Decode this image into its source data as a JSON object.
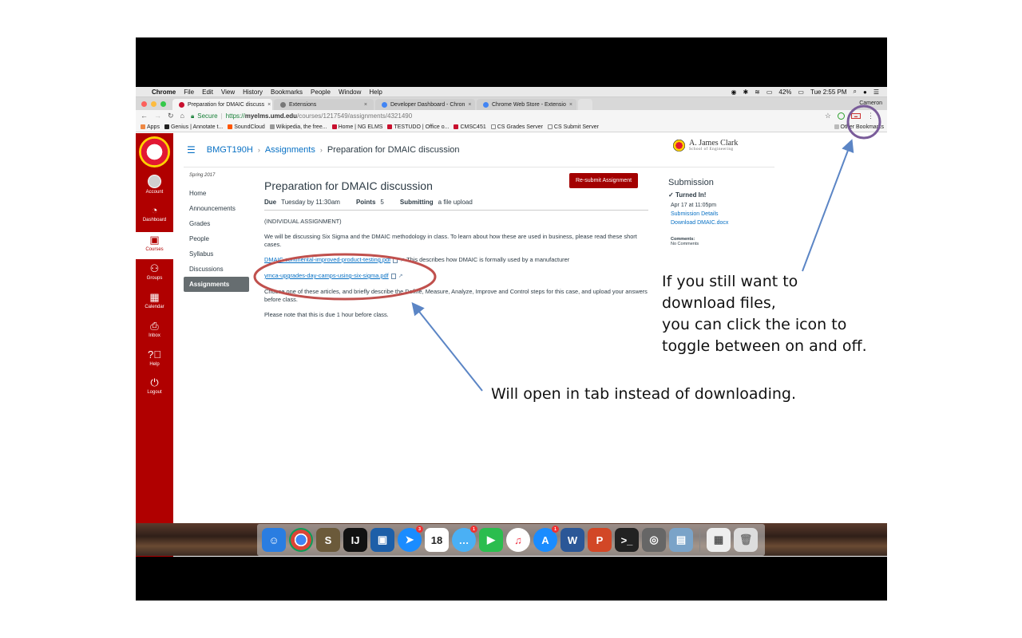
{
  "menubar": {
    "app": "Chrome",
    "menus": [
      "File",
      "Edit",
      "View",
      "History",
      "Bookmarks",
      "People",
      "Window",
      "Help"
    ],
    "battery": "42%",
    "time": "Tue 2:55 PM"
  },
  "tabs": [
    {
      "label": "Preparation for DMAIC discuss",
      "active": true
    },
    {
      "label": "Extensions",
      "active": false
    },
    {
      "label": "Developer Dashboard - Chron",
      "active": false
    },
    {
      "label": "Chrome Web Store - Extensio",
      "active": false
    }
  ],
  "profile": "Cameron",
  "address": {
    "secure_label": "Secure",
    "scheme": "https://",
    "host": "myelms.umd.edu",
    "path": "/courses/1217549/assignments/4321490"
  },
  "bookmarks": [
    "Apps",
    "Genius | Annotate t...",
    "SoundCloud",
    "Wikipedia, the free...",
    "Home | NG ELMS",
    "TESTUDO | Office o...",
    "CMSC451",
    "CS Grades Server",
    "CS Submit Server"
  ],
  "other_bookmarks": "Other Bookmarks",
  "global_nav": [
    {
      "label": "Account",
      "icon": "account-icon"
    },
    {
      "label": "Dashboard",
      "icon": "dashboard-icon"
    },
    {
      "label": "Courses",
      "icon": "courses-icon"
    },
    {
      "label": "Groups",
      "icon": "groups-icon"
    },
    {
      "label": "Calendar",
      "icon": "calendar-icon"
    },
    {
      "label": "Inbox",
      "icon": "inbox-icon"
    },
    {
      "label": "Help",
      "icon": "help-icon"
    },
    {
      "label": "Logout",
      "icon": "logout-icon"
    }
  ],
  "breadcrumb": {
    "course": "BMGT190H",
    "section": "Assignments",
    "current": "Preparation for DMAIC discussion"
  },
  "brand": {
    "line1": "A. James Clark",
    "line2": "School of Engineering"
  },
  "course_nav": {
    "term": "Spring 2017",
    "items": [
      "Home",
      "Announcements",
      "Grades",
      "People",
      "Syllabus",
      "Discussions",
      "Assignments"
    ]
  },
  "assignment": {
    "title": "Preparation for DMAIC discussion",
    "resubmit_label": "Re-submit Assignment",
    "due_label": "Due",
    "due_value": "Tuesday by 11:30am",
    "points_label": "Points",
    "points_value": "5",
    "submitting_label": "Submitting",
    "submitting_value": "a file upload",
    "heading": "(INDIVIDUAL ASSIGNMENT)",
    "intro": "We will be discussing Six Sigma and the DMAIC methodology in class.  To learn about how these are used in business, please read these short cases.",
    "file1": "DMAIC continental-improved-product-testing.pdf",
    "file1_note": "This describes how DMAIC is formally used by a manufacturer",
    "file2": "ymca-upgrades-day-camps-using-six-sigma.pdf",
    "instructions": "Choose one of these articles, and briefly describe the Define, Measure, Analyze, Improve and Control steps for this case, and upload your answers before class.",
    "note": "Please note that this is due 1 hour before class."
  },
  "submission": {
    "title": "Submission",
    "status": "Turned In!",
    "date": "Apr 17 at 11:05pm",
    "details_link": "Submission Details",
    "download_link": "Download DMAIC.docx",
    "comments_label": "Comments:",
    "comments_value": "No Comments"
  },
  "dock": {
    "calendar_day": "18",
    "badges": {
      "safari": "3",
      "messages": "1",
      "appstore": "1"
    }
  },
  "annotations": {
    "right_lines": [
      "If you still want to",
      "download files,",
      "you can click the icon to",
      "toggle between on and off."
    ],
    "bottom": "Will open in tab instead of downloading."
  },
  "colors": {
    "umd_red": "#b00000",
    "link_blue": "#0770c4",
    "button_red": "#a30000",
    "annotation_stroke": "#5b85c5",
    "circle_red": "#c0504d",
    "circle_purple": "#7a5c9a"
  }
}
